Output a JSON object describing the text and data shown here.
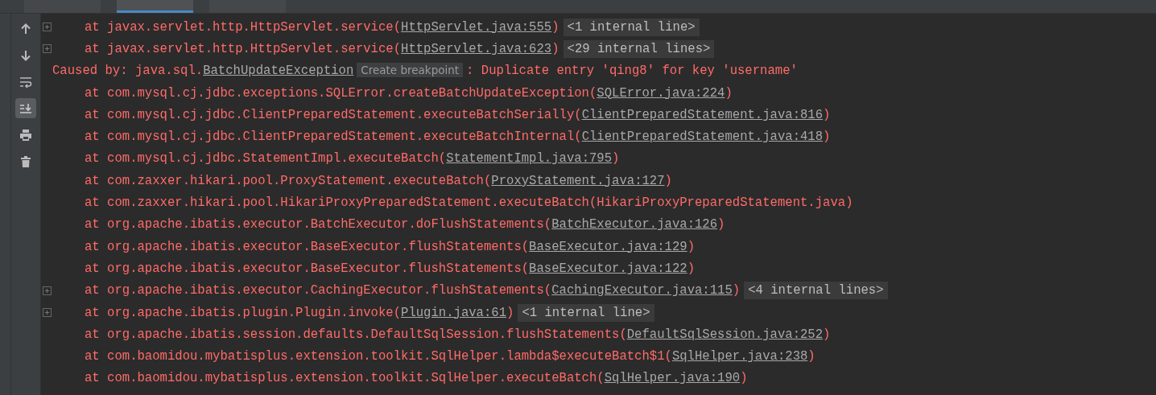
{
  "tool_window": {
    "tabs": [
      {
        "selected": false
      },
      {
        "selected": true
      },
      {
        "selected": false
      }
    ]
  },
  "toolbar": [
    {
      "kind": "up",
      "on": false
    },
    {
      "kind": "down",
      "on": false
    },
    {
      "kind": "wrap",
      "on": false
    },
    {
      "kind": "scroll-end",
      "on": true
    },
    {
      "kind": "print",
      "on": false
    },
    {
      "kind": "trash",
      "on": false
    }
  ],
  "lines": [
    {
      "kind": "frame",
      "foldable": true,
      "text": "at javax.servlet.http.HttpServlet.service(",
      "link": "HttpServlet.java:555",
      "close": ")",
      "collapsed": "<1 internal line>"
    },
    {
      "kind": "frame",
      "foldable": true,
      "text": "at javax.servlet.http.HttpServlet.service(",
      "link": "HttpServlet.java:623",
      "close": ")",
      "collapsed": "<29 internal lines>"
    },
    {
      "kind": "cause",
      "foldable": false,
      "text": "Caused by: java.sql.",
      "link": "BatchUpdateException",
      "hint": "Create breakpoint",
      "close": ": Duplicate entry 'qing8' for key 'username'"
    },
    {
      "kind": "frame",
      "foldable": false,
      "text": "at com.mysql.cj.jdbc.exceptions.SQLError.createBatchUpdateException(",
      "link": "SQLError.java:224",
      "close": ")"
    },
    {
      "kind": "frame",
      "foldable": false,
      "text": "at com.mysql.cj.jdbc.ClientPreparedStatement.executeBatchSerially(",
      "link": "ClientPreparedStatement.java:816",
      "close": ")"
    },
    {
      "kind": "frame",
      "foldable": false,
      "text": "at com.mysql.cj.jdbc.ClientPreparedStatement.executeBatchInternal(",
      "link": "ClientPreparedStatement.java:418",
      "close": ")"
    },
    {
      "kind": "frame",
      "foldable": false,
      "text": "at com.mysql.cj.jdbc.StatementImpl.executeBatch(",
      "link": "StatementImpl.java:795",
      "close": ")"
    },
    {
      "kind": "frame",
      "foldable": false,
      "text": "at com.zaxxer.hikari.pool.ProxyStatement.executeBatch(",
      "link": "ProxyStatement.java:127",
      "close": ")"
    },
    {
      "kind": "frame",
      "foldable": false,
      "text": "at com.zaxxer.hikari.pool.HikariProxyPreparedStatement.executeBatch(HikariProxyPreparedStatement.java)"
    },
    {
      "kind": "frame",
      "foldable": false,
      "text": "at org.apache.ibatis.executor.BatchExecutor.doFlushStatements(",
      "link": "BatchExecutor.java:126",
      "close": ")"
    },
    {
      "kind": "frame",
      "foldable": false,
      "text": "at org.apache.ibatis.executor.BaseExecutor.flushStatements(",
      "link": "BaseExecutor.java:129",
      "close": ")"
    },
    {
      "kind": "frame",
      "foldable": false,
      "text": "at org.apache.ibatis.executor.BaseExecutor.flushStatements(",
      "link": "BaseExecutor.java:122",
      "close": ")"
    },
    {
      "kind": "frame",
      "foldable": true,
      "text": "at org.apache.ibatis.executor.CachingExecutor.flushStatements(",
      "link": "CachingExecutor.java:115",
      "close": ")",
      "collapsed": "<4 internal lines>"
    },
    {
      "kind": "frame",
      "foldable": true,
      "text": "at org.apache.ibatis.plugin.Plugin.invoke(",
      "link": "Plugin.java:61",
      "close": ")",
      "collapsed": "<1 internal line>"
    },
    {
      "kind": "frame",
      "foldable": false,
      "text": "at org.apache.ibatis.session.defaults.DefaultSqlSession.flushStatements(",
      "link": "DefaultSqlSession.java:252",
      "close": ")"
    },
    {
      "kind": "frame",
      "foldable": false,
      "text": "at com.baomidou.mybatisplus.extension.toolkit.SqlHelper.lambda$executeBatch$1(",
      "link": "SqlHelper.java:238",
      "close": ")"
    },
    {
      "kind": "frame",
      "foldable": false,
      "text": "at com.baomidou.mybatisplus.extension.toolkit.SqlHelper.executeBatch(",
      "link": "SqlHelper.java:190",
      "close": ")"
    }
  ]
}
